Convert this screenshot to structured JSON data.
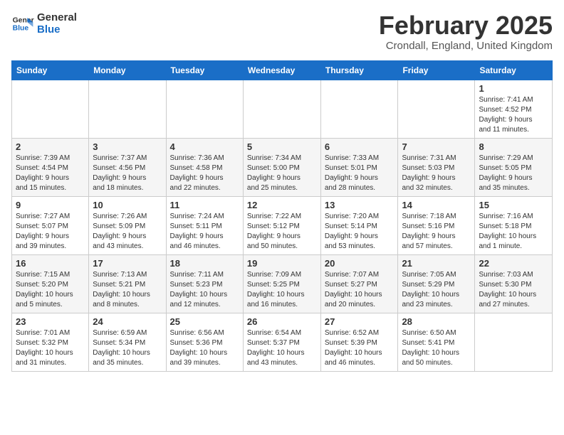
{
  "logo": {
    "line1": "General",
    "line2": "Blue"
  },
  "title": "February 2025",
  "subtitle": "Crondall, England, United Kingdom",
  "weekdays": [
    "Sunday",
    "Monday",
    "Tuesday",
    "Wednesday",
    "Thursday",
    "Friday",
    "Saturday"
  ],
  "weeks": [
    [
      {
        "day": "",
        "detail": ""
      },
      {
        "day": "",
        "detail": ""
      },
      {
        "day": "",
        "detail": ""
      },
      {
        "day": "",
        "detail": ""
      },
      {
        "day": "",
        "detail": ""
      },
      {
        "day": "",
        "detail": ""
      },
      {
        "day": "1",
        "detail": "Sunrise: 7:41 AM\nSunset: 4:52 PM\nDaylight: 9 hours\nand 11 minutes."
      }
    ],
    [
      {
        "day": "2",
        "detail": "Sunrise: 7:39 AM\nSunset: 4:54 PM\nDaylight: 9 hours\nand 15 minutes."
      },
      {
        "day": "3",
        "detail": "Sunrise: 7:37 AM\nSunset: 4:56 PM\nDaylight: 9 hours\nand 18 minutes."
      },
      {
        "day": "4",
        "detail": "Sunrise: 7:36 AM\nSunset: 4:58 PM\nDaylight: 9 hours\nand 22 minutes."
      },
      {
        "day": "5",
        "detail": "Sunrise: 7:34 AM\nSunset: 5:00 PM\nDaylight: 9 hours\nand 25 minutes."
      },
      {
        "day": "6",
        "detail": "Sunrise: 7:33 AM\nSunset: 5:01 PM\nDaylight: 9 hours\nand 28 minutes."
      },
      {
        "day": "7",
        "detail": "Sunrise: 7:31 AM\nSunset: 5:03 PM\nDaylight: 9 hours\nand 32 minutes."
      },
      {
        "day": "8",
        "detail": "Sunrise: 7:29 AM\nSunset: 5:05 PM\nDaylight: 9 hours\nand 35 minutes."
      }
    ],
    [
      {
        "day": "9",
        "detail": "Sunrise: 7:27 AM\nSunset: 5:07 PM\nDaylight: 9 hours\nand 39 minutes."
      },
      {
        "day": "10",
        "detail": "Sunrise: 7:26 AM\nSunset: 5:09 PM\nDaylight: 9 hours\nand 43 minutes."
      },
      {
        "day": "11",
        "detail": "Sunrise: 7:24 AM\nSunset: 5:11 PM\nDaylight: 9 hours\nand 46 minutes."
      },
      {
        "day": "12",
        "detail": "Sunrise: 7:22 AM\nSunset: 5:12 PM\nDaylight: 9 hours\nand 50 minutes."
      },
      {
        "day": "13",
        "detail": "Sunrise: 7:20 AM\nSunset: 5:14 PM\nDaylight: 9 hours\nand 53 minutes."
      },
      {
        "day": "14",
        "detail": "Sunrise: 7:18 AM\nSunset: 5:16 PM\nDaylight: 9 hours\nand 57 minutes."
      },
      {
        "day": "15",
        "detail": "Sunrise: 7:16 AM\nSunset: 5:18 PM\nDaylight: 10 hours\nand 1 minute."
      }
    ],
    [
      {
        "day": "16",
        "detail": "Sunrise: 7:15 AM\nSunset: 5:20 PM\nDaylight: 10 hours\nand 5 minutes."
      },
      {
        "day": "17",
        "detail": "Sunrise: 7:13 AM\nSunset: 5:21 PM\nDaylight: 10 hours\nand 8 minutes."
      },
      {
        "day": "18",
        "detail": "Sunrise: 7:11 AM\nSunset: 5:23 PM\nDaylight: 10 hours\nand 12 minutes."
      },
      {
        "day": "19",
        "detail": "Sunrise: 7:09 AM\nSunset: 5:25 PM\nDaylight: 10 hours\nand 16 minutes."
      },
      {
        "day": "20",
        "detail": "Sunrise: 7:07 AM\nSunset: 5:27 PM\nDaylight: 10 hours\nand 20 minutes."
      },
      {
        "day": "21",
        "detail": "Sunrise: 7:05 AM\nSunset: 5:29 PM\nDaylight: 10 hours\nand 23 minutes."
      },
      {
        "day": "22",
        "detail": "Sunrise: 7:03 AM\nSunset: 5:30 PM\nDaylight: 10 hours\nand 27 minutes."
      }
    ],
    [
      {
        "day": "23",
        "detail": "Sunrise: 7:01 AM\nSunset: 5:32 PM\nDaylight: 10 hours\nand 31 minutes."
      },
      {
        "day": "24",
        "detail": "Sunrise: 6:59 AM\nSunset: 5:34 PM\nDaylight: 10 hours\nand 35 minutes."
      },
      {
        "day": "25",
        "detail": "Sunrise: 6:56 AM\nSunset: 5:36 PM\nDaylight: 10 hours\nand 39 minutes."
      },
      {
        "day": "26",
        "detail": "Sunrise: 6:54 AM\nSunset: 5:37 PM\nDaylight: 10 hours\nand 43 minutes."
      },
      {
        "day": "27",
        "detail": "Sunrise: 6:52 AM\nSunset: 5:39 PM\nDaylight: 10 hours\nand 46 minutes."
      },
      {
        "day": "28",
        "detail": "Sunrise: 6:50 AM\nSunset: 5:41 PM\nDaylight: 10 hours\nand 50 minutes."
      },
      {
        "day": "",
        "detail": ""
      }
    ]
  ]
}
